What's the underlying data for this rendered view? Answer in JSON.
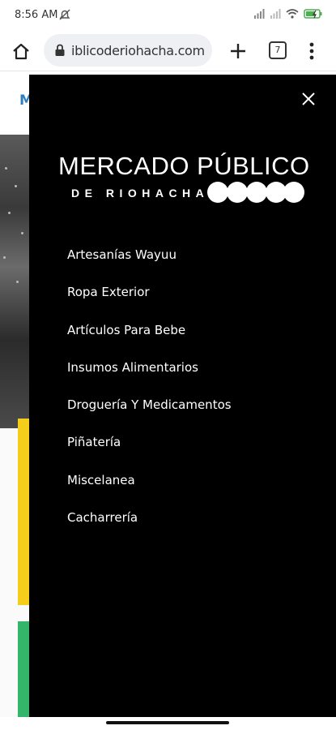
{
  "status_bar": {
    "time": "8:56 AM",
    "notification_icon": "mute-notification-icon",
    "signal_icon": "signal-icon",
    "wifi_icon": "wifi-icon",
    "battery_icon": "battery-charging-icon"
  },
  "browser": {
    "url": "iblicoderiohacha.com",
    "tab_count": "7",
    "home_icon": "home-icon",
    "lock_icon": "lock-icon",
    "new_tab_icon": "plus-icon",
    "menu_icon": "more-vert-icon"
  },
  "page": {
    "logo_fragment": "M",
    "accent_yellow": "#f5cd1b",
    "accent_green": "#33b56a"
  },
  "drawer": {
    "background": "#000000",
    "close_icon": "close-icon",
    "brand_title": "MERCADO PÚBLICO",
    "brand_subtitle": "DE RIOHACHA",
    "menu_items": [
      "Artesanías Wayuu",
      "Ropa Exterior",
      "Artículos Para Bebe",
      "Insumos Alimentarios",
      "Droguería Y Medicamentos",
      "Piñatería",
      "Miscelanea",
      "Cacharrería"
    ]
  }
}
